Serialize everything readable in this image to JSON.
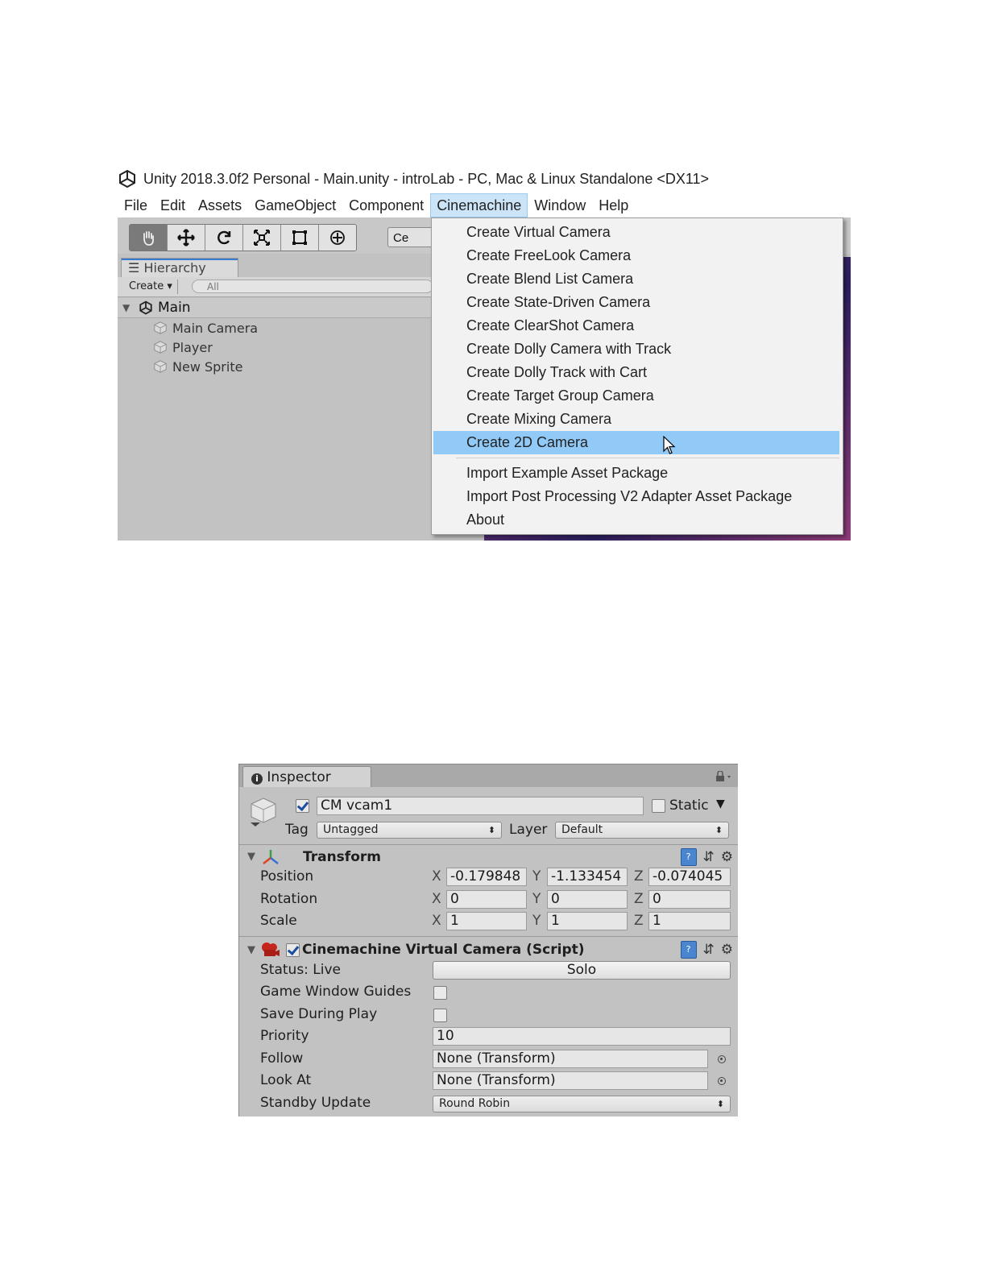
{
  "editor": {
    "window_title": "Unity 2018.3.0f2 Personal - Main.unity - introLab - PC, Mac & Linux Standalone <DX11>",
    "menu": [
      "File",
      "Edit",
      "Assets",
      "GameObject",
      "Component",
      "Cinemachine",
      "Window",
      "Help"
    ],
    "open_menu": "Cinemachine",
    "toolbar": {
      "tools": [
        "hand-icon",
        "move-icon",
        "rotate-icon",
        "scale-icon",
        "rect-icon",
        "transform-icon"
      ],
      "active_tool": "hand-icon",
      "center_label": "Ce"
    },
    "hierarchy": {
      "tab_label": "Hierarchy",
      "create_label": "Create",
      "search_placeholder": "All",
      "scene_name": "Main",
      "items": [
        "Main Camera",
        "Player",
        "New Sprite"
      ]
    },
    "dropdown": {
      "items": [
        "Create Virtual Camera",
        "Create FreeLook Camera",
        "Create Blend List Camera",
        "Create State-Driven Camera",
        "Create ClearShot Camera",
        "Create Dolly Camera with Track",
        "Create Dolly Track with Cart",
        "Create Target Group Camera",
        "Create Mixing Camera",
        "Create 2D Camera"
      ],
      "highlighted": "Create 2D Camera",
      "items_after_separator": [
        "Import Example Asset Package",
        "Import Post Processing V2 Adapter Asset Package",
        "About"
      ],
      "highlight_color": "#91c9f7"
    }
  },
  "inspector": {
    "tab_label": "Inspector",
    "object": {
      "active": true,
      "name": "CM vcam1",
      "static_label": "Static",
      "static": false,
      "tag_label": "Tag",
      "tag_value": "Untagged",
      "layer_label": "Layer",
      "layer_value": "Default"
    },
    "transform": {
      "title": "Transform",
      "rows": [
        {
          "label": "Position",
          "x": "-0.179848",
          "y": "-1.133454",
          "z": "-0.074045"
        },
        {
          "label": "Rotation",
          "x": "0",
          "y": "0",
          "z": "0"
        },
        {
          "label": "Scale",
          "x": "1",
          "y": "1",
          "z": "1"
        }
      ],
      "axis_labels": [
        "X",
        "Y",
        "Z"
      ]
    },
    "vcam": {
      "title": "Cinemachine Virtual Camera (Script)",
      "enabled": true,
      "status_label": "Status: Live",
      "solo_label": "Solo",
      "game_window_guides_label": "Game Window Guides",
      "game_window_guides": false,
      "save_during_play_label": "Save During Play",
      "save_during_play": false,
      "priority_label": "Priority",
      "priority_value": "10",
      "follow_label": "Follow",
      "follow_value": "None (Transform)",
      "look_at_label": "Look At",
      "look_at_value": "None (Transform)",
      "standby_label": "Standby Update",
      "standby_value": "Round Robin"
    }
  }
}
